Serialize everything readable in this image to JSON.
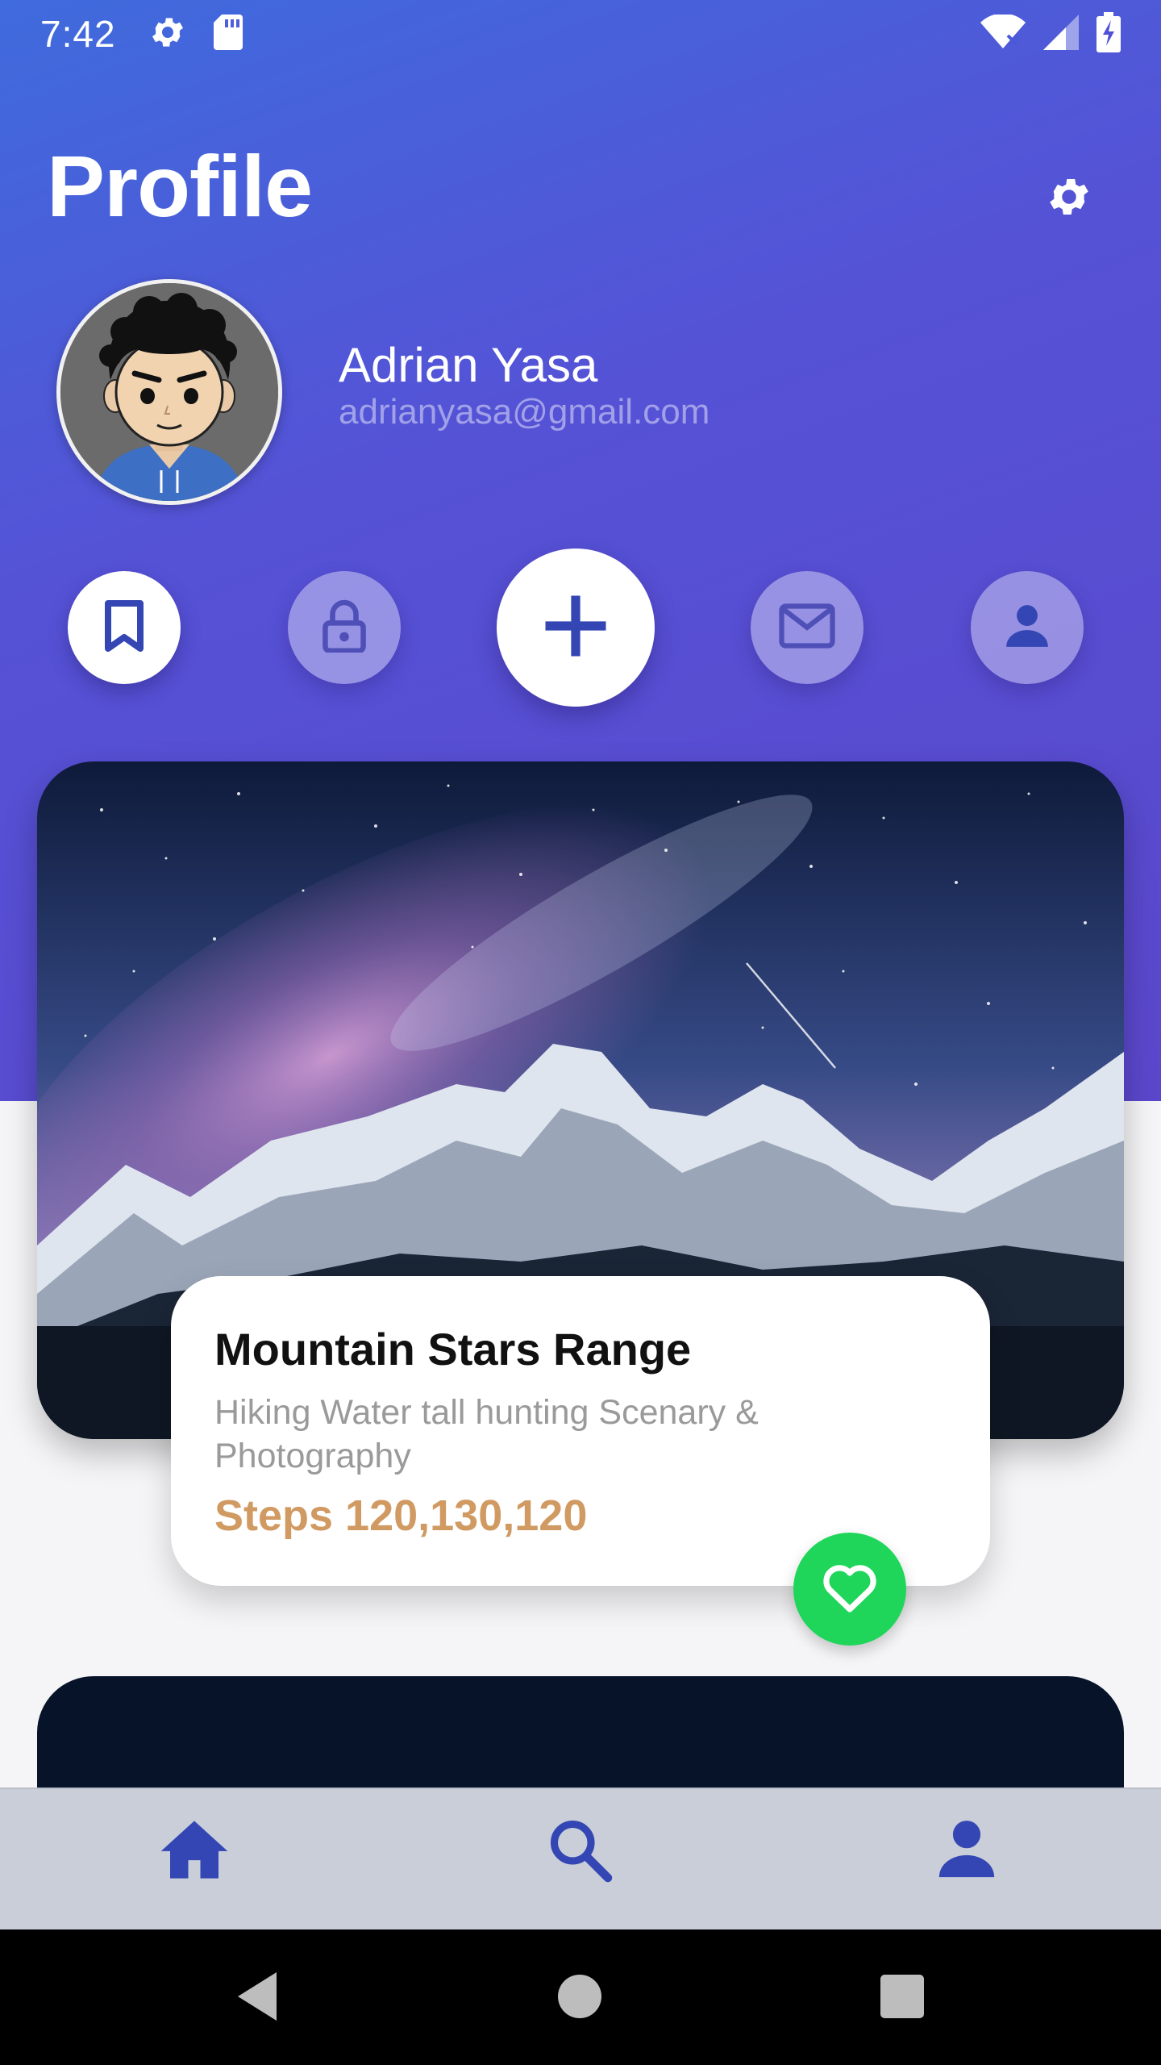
{
  "status_bar": {
    "time": "7:42",
    "left_icons": [
      "gear-icon",
      "sd-card-icon"
    ],
    "right_icons": [
      "wifi-icon",
      "signal-icon",
      "battery-charging-icon"
    ]
  },
  "header": {
    "title": "Profile",
    "settings_icon": "gear-icon"
  },
  "user": {
    "name": "Adrian Yasa",
    "email": "adrianyasa@gmail.com"
  },
  "actions": [
    {
      "icon": "bookmark-icon",
      "active": true
    },
    {
      "icon": "lock-icon",
      "active": false
    },
    {
      "icon": "plus-icon",
      "active": true
    },
    {
      "icon": "mail-icon",
      "active": false
    },
    {
      "icon": "person-icon",
      "active": false
    }
  ],
  "card": {
    "title": "Mountain Stars Range",
    "subtitle": "Hiking Water tall hunting Scenary & Photography",
    "steps": "Steps 120,130,120",
    "favorite_icon": "heart-icon"
  },
  "bottom_nav": {
    "items": [
      {
        "icon": "home-icon",
        "active": true
      },
      {
        "icon": "search-icon",
        "active": false
      },
      {
        "icon": "person-icon",
        "active": false
      }
    ]
  },
  "system_nav": [
    "back-icon",
    "home-circle-icon",
    "recents-icon"
  ],
  "colors": {
    "gradient_start": "#3f6bdd",
    "gradient_end": "#5b47cc",
    "accent": "#3346b4",
    "steps": "#d09a62",
    "favorite": "#1fd65a"
  }
}
